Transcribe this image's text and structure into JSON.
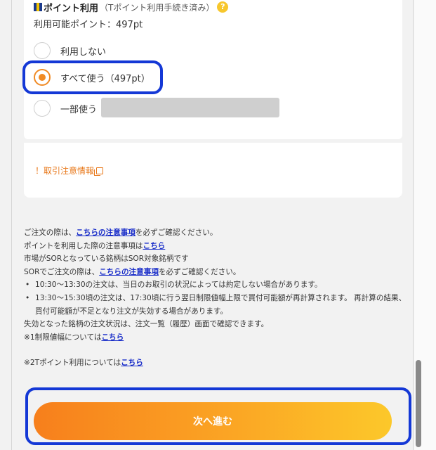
{
  "point_section": {
    "title": "ポイント利用",
    "subtitle": "（Tポイント利用手続き済み）",
    "help_glyph": "?",
    "available": "利用可能ポイント：497pt",
    "options": [
      {
        "label": "利用しない",
        "checked": false
      },
      {
        "label": "すべて使う（497pt）",
        "checked": true
      },
      {
        "label": "一部使う",
        "checked": false
      }
    ],
    "partial_input_value": ""
  },
  "caution": {
    "link_text": "！取引注意情報"
  },
  "notes": {
    "l1_pre": "ご注文の際は、",
    "l1_link": "こちらの注意事項",
    "l1_post": "を必ずご確認ください。",
    "l2_pre": "ポイントを利用した際の注意事項は",
    "l2_link": "こちら",
    "l3": "市場がSORとなっている銘柄はSOR対象銘柄です",
    "l4_pre": "SORでご注文の際は、",
    "l4_link": "こちらの注意事項",
    "l4_post": "を必ずご確認ください。",
    "b1": "10:30〜13:30の注文は、当日のお取引の状況によっては約定しない場合があります。",
    "b2": "13:30〜15:30頃の注文は、17:30頃に行う翌日制限値幅上限で買付可能額が再計算されます。 再計算の結果、買付可能額が不足となり注文が失効する場合があります。",
    "l5": "失効となった銘柄の注文状況は、注文一覧（履歴）画面で確認できます。",
    "l6_pre": "※1制限値幅については",
    "l6_link": "こちら",
    "l7_pre": "※2Tポイント利用については",
    "l7_link": "こちら"
  },
  "next_button": {
    "label": "次へ進む"
  },
  "colors": {
    "accent_orange": "#f08a24",
    "link_blue": "#1a2ec9",
    "highlight_blue": "#1438d6"
  }
}
